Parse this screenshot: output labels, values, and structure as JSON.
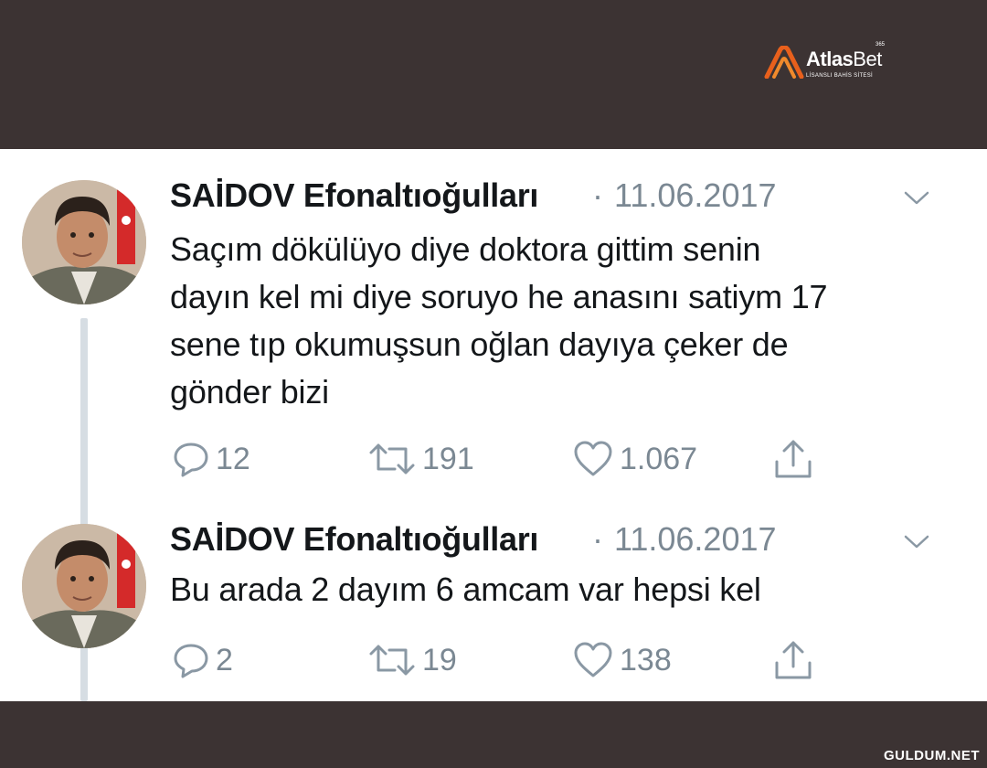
{
  "branding": {
    "logo_main": "Atlas",
    "logo_thin": "Bet",
    "logo_badge": "365",
    "logo_tagline": "LİSANSLI BAHİS SİTESİ",
    "watermark": "GULDUM.NET"
  },
  "colors": {
    "background": "#3c3333",
    "panel": "#ffffff",
    "text": "#14171a",
    "muted": "#7b8893",
    "thread_line": "#d6dde3",
    "logo_accent": "#e8601c"
  },
  "tweets": [
    {
      "author": "SAİDOV Efonaltıoğulları",
      "separator": "·",
      "date": "11.06.2017",
      "lines": [
        "Saçım dökülüyo diye doktora gittim senin",
        "dayın kel mi diye soruyo he anasını satiym 17",
        "sene tıp okumuşsun oğlan dayıya çeker de",
        "gönder bizi"
      ],
      "replies": "12",
      "retweets": "191",
      "likes": "1.067"
    },
    {
      "author": "SAİDOV Efonaltıoğulları",
      "separator": "·",
      "date": "11.06.2017",
      "lines": [
        "Bu arada 2 dayım 6 amcam var hepsi kel"
      ],
      "replies": "2",
      "retweets": "19",
      "likes": "138"
    }
  ]
}
